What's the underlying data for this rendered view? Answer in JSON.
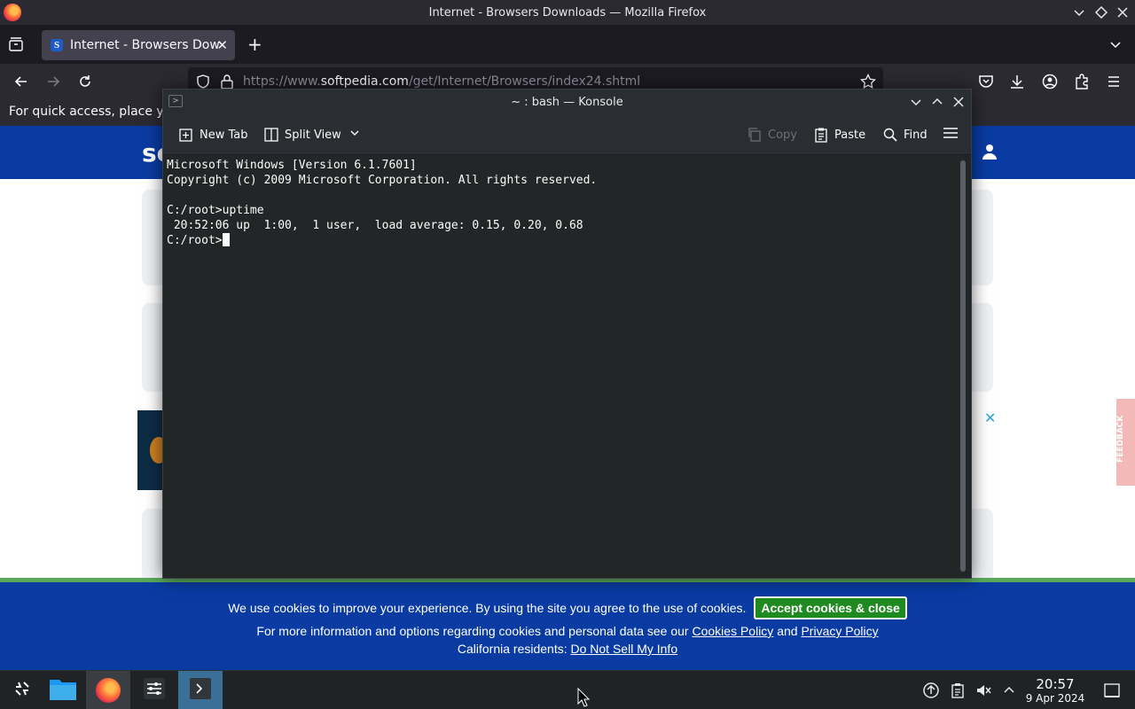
{
  "firefox": {
    "window_title": "Internet - Browsers Downloads — Mozilla Firefox",
    "tab_title": "Internet - Browsers Downloads",
    "url_domain_prefix": "https://www.",
    "url_domain": "softpedia.com",
    "url_path": "/get/Internet/Browsers/index24.shtml",
    "bookmarks_message": "For quick access, place yo"
  },
  "page": {
    "logo_text": "so",
    "feedback_label": "FEEDBACK",
    "cookie": {
      "line1": "We use cookies to improve your experience. By using the site you agree to the use of cookies.",
      "accept_label": "Accept cookies & close",
      "line2_prefix": "For more information and options regarding cookies and personal data see our",
      "cookies_policy_link": "Cookies Policy",
      "and_text": "and",
      "privacy_policy_link": "Privacy Policy",
      "line3_prefix": "California residents:",
      "do_not_sell_link": "Do Not Sell My Info"
    }
  },
  "konsole": {
    "window_title": "~ : bash — Konsole",
    "toolbar": {
      "new_tab": "New Tab",
      "split_view": "Split View",
      "copy": "Copy",
      "paste": "Paste",
      "find": "Find"
    },
    "terminal_lines": [
      "Microsoft Windows [Version 6.1.7601]",
      "Copyright (c) 2009 Microsoft Corporation. All rights reserved.",
      "",
      "C:/root>uptime",
      " 20:52:06 up  1:00,  1 user,  load average: 0.15, 0.20, 0.68"
    ],
    "prompt": "C:/root>"
  },
  "taskbar": {
    "time": "20:57",
    "date": "9 Apr 2024"
  },
  "colors": {
    "softpedia_blue": "#0a3ba2",
    "accept_green": "#1f8a1f",
    "konsole_bg": "#232627"
  }
}
